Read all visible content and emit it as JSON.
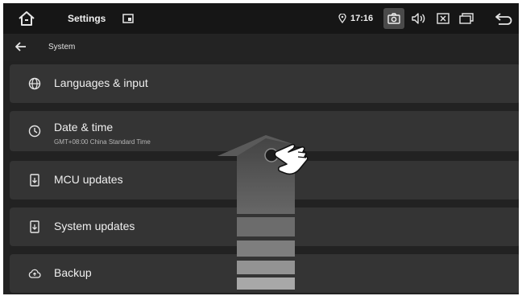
{
  "statusbar": {
    "app_title": "Settings",
    "time": "17:16"
  },
  "subheader": {
    "title": "System"
  },
  "items": [
    {
      "label": "Languages & input"
    },
    {
      "label": "Date & time",
      "sublabel": "GMT+08:00 China Standard Time"
    },
    {
      "label": "MCU updates"
    },
    {
      "label": "System updates"
    },
    {
      "label": "Backup"
    }
  ],
  "colors": {
    "background": "#222222",
    "statusbar": "#161616",
    "list_item": "#343434",
    "text": "#efefef"
  }
}
